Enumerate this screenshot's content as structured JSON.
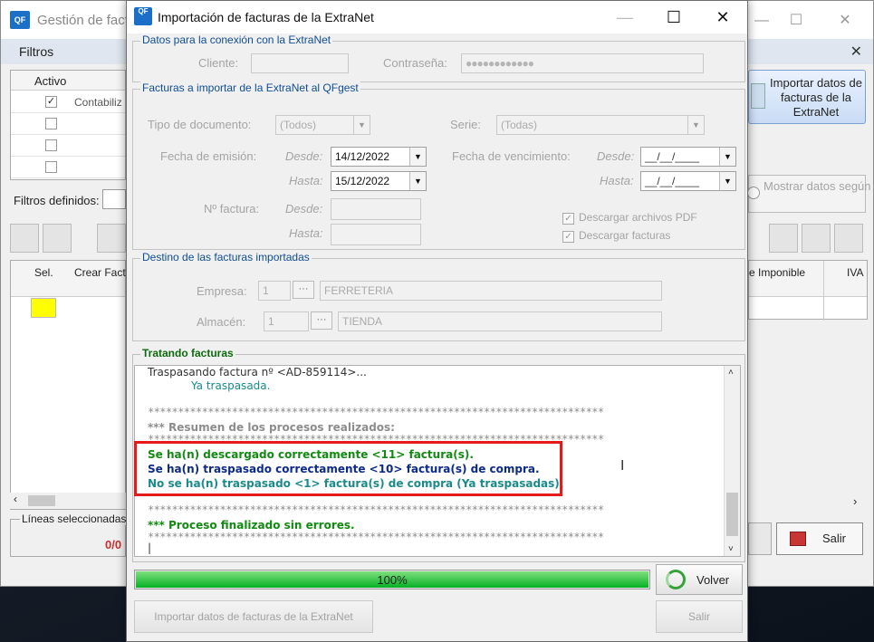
{
  "background_window": {
    "logo": "QF",
    "title": "Gestión de factu",
    "winbtns": [
      "—",
      "☐",
      "✕"
    ],
    "menu": "Filtros",
    "menu_close": "✕",
    "filter_grid": {
      "header": "Activo",
      "row1_text": "Contabiliz"
    },
    "filtros_definidos": "Filtros definidos:",
    "main_grid": {
      "col_sel": "Sel.",
      "col_crear": "Crear Fact"
    },
    "lineas_seleccionadas": "Líneas seleccionadas",
    "lineas_value": "0/0",
    "right_import_button": "Importar datos de facturas de la ExtraNet",
    "mostrar_button": "Mostrar datos según filtros",
    "grid_right": {
      "col_base": "e Imponible",
      "col_iva": "IVA"
    },
    "salir": "Salir",
    "scroll_left": "‹",
    "scroll_right": "›"
  },
  "dialog": {
    "logo": "QF",
    "title": "Importación de facturas de la ExtraNet",
    "winbtns": [
      "—",
      "☐",
      "✕"
    ],
    "conexion": {
      "group_title": "Datos para la conexión con la ExtraNet",
      "cliente_label": "Cliente:",
      "cliente_value": "",
      "password_label": "Contraseña:",
      "password_value": "●●●●●●●●●●●●"
    },
    "facturas": {
      "group_title": "Facturas a importar de la ExtraNet al QFgest",
      "tipo_label": "Tipo de documento:",
      "tipo_value": "(Todos)",
      "serie_label": "Serie:",
      "serie_value": "(Todas)",
      "emision_label": "Fecha de emisión:",
      "desde_label": "Desde:",
      "hasta_label": "Hasta:",
      "emision_desde": "14/12/2022",
      "emision_hasta": "15/12/2022",
      "vencimiento_label": "Fecha de vencimiento:",
      "vencimiento_desde": "__/__/____",
      "vencimiento_hasta": "__/__/____",
      "nfactura_label": "Nº factura:",
      "nfactura_desde": "",
      "nfactura_hasta": "",
      "descargar_pdf_label": "Descargar archivos PDF",
      "descargar_pdf_checked": true,
      "descargar_facturas_label": "Descargar facturas",
      "descargar_facturas_checked": true
    },
    "destino": {
      "group_title": "Destino de las facturas importadas",
      "empresa_label": "Empresa:",
      "empresa_code": "1",
      "empresa_name": "FERRETERIA",
      "almacen_label": "Almacén:",
      "almacen_code": "1",
      "almacen_name": "TIENDA",
      "dots": "···"
    },
    "tratando": {
      "group_title": "Tratando facturas",
      "lines": {
        "l1": "Traspasando factura nº <AD-859114>...",
        "l2": "Ya traspasada.",
        "stars": "****************************************************************************",
        "resumen": "***  Resumen de los procesos realizados:",
        "desc": "Se ha(n) descargado correctamente <11> factura(s).",
        "trasp": "Se ha(n) traspasado correctamente <10> factura(s) de compra.",
        "notrasp": "No se ha(n) traspasado <1> factura(s) de compra (Ya traspasadas).",
        "fin": "***  Proceso finalizado sin errores.",
        "caret": "|"
      },
      "colors": {
        "grey": "#8c8c8c",
        "teal": "#1a8a8a",
        "green": "#118a11",
        "navy": "#0d2b86",
        "black": "#333333"
      }
    },
    "progress": {
      "value": 100,
      "label": "100%"
    },
    "volver_button": "Volver",
    "importar_button": "Importar datos de facturas de la ExtraNet",
    "salir_button": "Salir",
    "icons": {
      "dropdown": "▼",
      "check": "✓",
      "scroll_up": "˄",
      "scroll_down": "˅",
      "text_cursor": "I"
    }
  }
}
